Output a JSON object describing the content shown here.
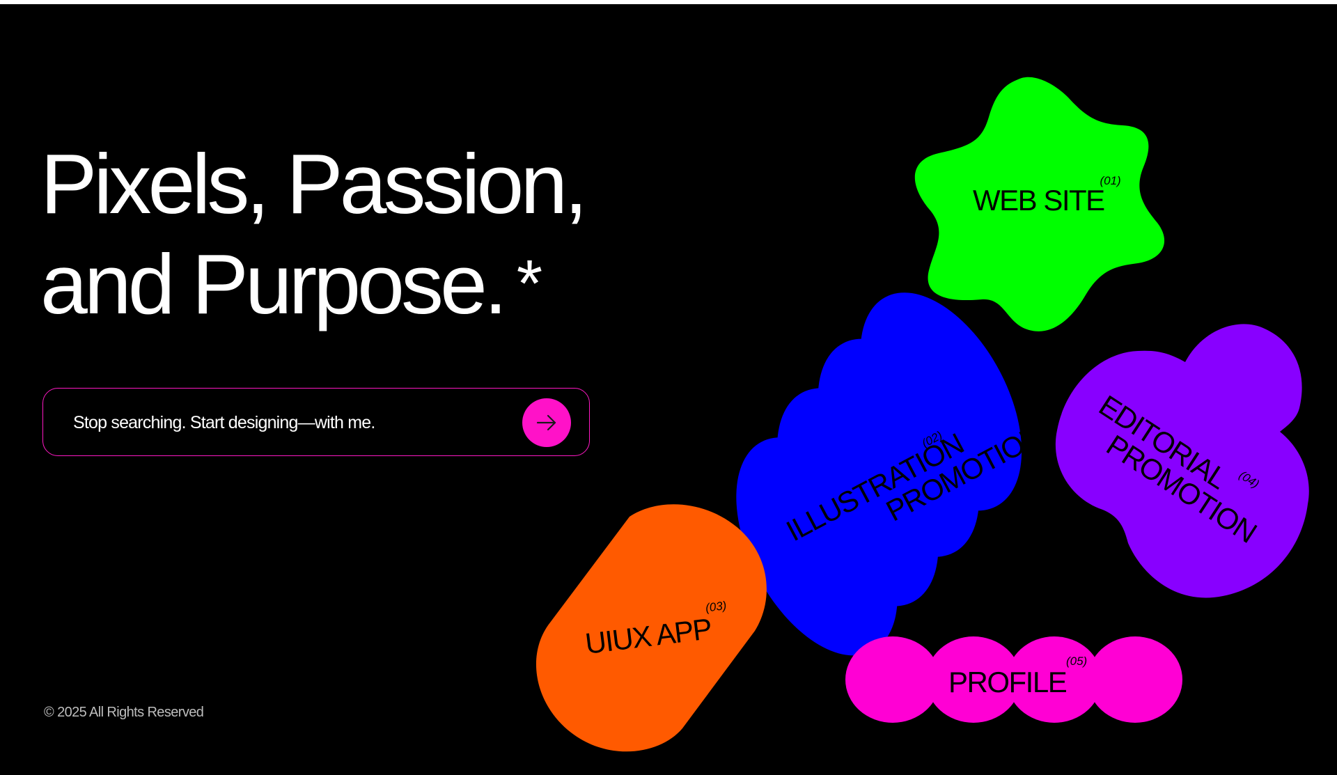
{
  "hero": {
    "line1": "Pixels, Passion,",
    "line2": "and Purpose.",
    "asterisk": "*"
  },
  "cta": {
    "text": "Stop searching. Start designing—with me.",
    "button_icon": "arrow-right-icon"
  },
  "footer": {
    "copyright": "© 2025 All Rights Reserved"
  },
  "categories": [
    {
      "label": "WEB SITE",
      "number": "(01)",
      "color": "#00ff00",
      "shape": "star"
    },
    {
      "label_line1": "ILLUSTRATION",
      "label_line2": "PROMOTION",
      "number": "(02)",
      "color": "#0000ff",
      "shape": "wave"
    },
    {
      "label": "UIUX APP",
      "number": "(03)",
      "color": "#ff5a00",
      "shape": "rounded-diagonal"
    },
    {
      "label_line1": "EDITORIAL",
      "label_line2": "PROMOTION",
      "number": "(04)",
      "color": "#8800ff",
      "shape": "cloud"
    },
    {
      "label": "PROFILE",
      "number": "(05)",
      "color": "#ff00d4",
      "shape": "circles"
    }
  ]
}
